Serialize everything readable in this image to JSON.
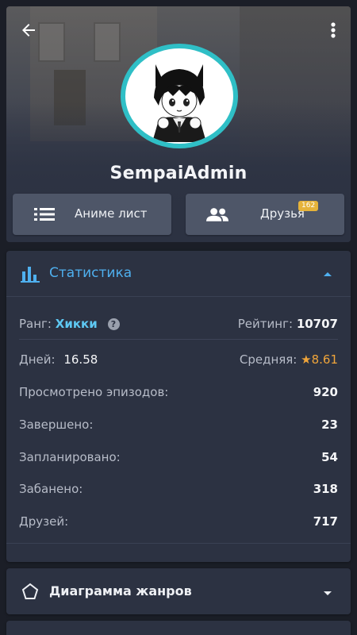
{
  "profile": {
    "username": "SempaiAdmin"
  },
  "header_buttons": {
    "anime_list": {
      "label": "Аниме лист",
      "icon": "list-icon"
    },
    "friends": {
      "label": "Друзья",
      "icon": "friends-icon",
      "badge": "162"
    }
  },
  "stats": {
    "title": "Статистика",
    "rank_label": "Ранг:",
    "rank_value": "Хикки",
    "rating_label": "Рейтинг:",
    "rating_value": "10707",
    "days_label": "Дней:",
    "days_value": "16.58",
    "avg_label": "Средняя:",
    "avg_value": "8.61",
    "rows": [
      {
        "label": "Просмотрено эпизодов:",
        "value": "920"
      },
      {
        "label": "Завершено:",
        "value": "23"
      },
      {
        "label": "Запланировано:",
        "value": "54"
      },
      {
        "label": "Забанено:",
        "value": "318"
      },
      {
        "label": "Друзей:",
        "value": "717"
      }
    ]
  },
  "genres": {
    "title": "Диаграмма жанров"
  },
  "colors": {
    "accent": "#4fb0ef",
    "rank": "#5ec8f2",
    "rating_star": "#f0a53a",
    "badge": "#e6b33a",
    "avatar_ring": "#2fbfc6"
  }
}
